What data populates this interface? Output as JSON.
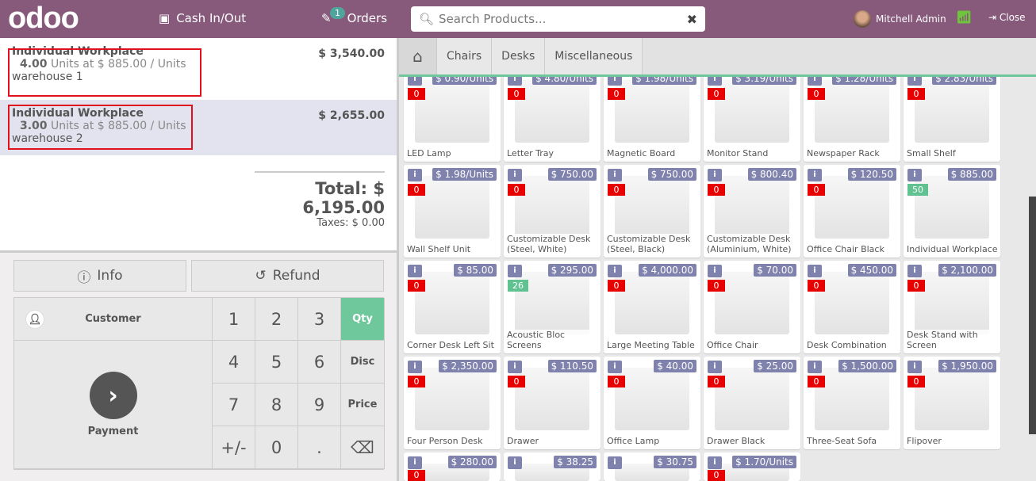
{
  "header": {
    "logo": "odoo",
    "cash": "Cash In/Out",
    "orders": "Orders",
    "orders_count": "1",
    "search_placeholder": "Search Products...",
    "user": "Mitchell Admin",
    "close": "Close"
  },
  "order": {
    "lines": [
      {
        "name": "Individual Workplace",
        "price": "$ 3,540.00",
        "qty": "4.00",
        "detail": "Units at $ 885.00 / Units",
        "note": "warehouse 1"
      },
      {
        "name": "Individual Workplace",
        "price": "$ 2,655.00",
        "qty": "3.00",
        "detail": "Units at $ 885.00 / Units",
        "note": "warehouse 2"
      }
    ],
    "total": "Total: $ 6,195.00",
    "taxes": "Taxes: $ 0.00"
  },
  "actions": {
    "info": "Info",
    "refund": "Refund"
  },
  "pad": {
    "customer": "Customer",
    "payment": "Payment",
    "keys": [
      "1",
      "2",
      "3",
      "Qty",
      "4",
      "5",
      "6",
      "Disc",
      "7",
      "8",
      "9",
      "Price",
      "+/-",
      "0",
      ".",
      "⌫"
    ],
    "active": "Qty"
  },
  "categories": [
    "Chairs",
    "Desks",
    "Miscellaneous"
  ],
  "products": [
    {
      "name": "LED Lamp",
      "price": "$ 0.90/Units",
      "qty": "0"
    },
    {
      "name": "Letter Tray",
      "price": "$ 4.80/Units",
      "qty": "0"
    },
    {
      "name": "Magnetic Board",
      "price": "$ 1.98/Units",
      "qty": "0"
    },
    {
      "name": "Monitor Stand",
      "price": "$ 3.19/Units",
      "qty": "0"
    },
    {
      "name": "Newspaper Rack",
      "price": "$ 1.28/Units",
      "qty": "0"
    },
    {
      "name": "Small Shelf",
      "price": "$ 2.83/Units",
      "qty": "0"
    },
    {
      "name": "Wall Shelf Unit",
      "price": "$ 1.98/Units",
      "qty": "0"
    },
    {
      "name": "Customizable Desk (Steel, White)",
      "price": "$ 750.00",
      "qty": "0"
    },
    {
      "name": "Customizable Desk (Steel, Black)",
      "price": "$ 750.00",
      "qty": "0"
    },
    {
      "name": "Customizable Desk (Aluminium, White)",
      "price": "$ 800.40",
      "qty": "0"
    },
    {
      "name": "Office Chair Black",
      "price": "$ 120.50",
      "qty": "0"
    },
    {
      "name": "Individual Workplace",
      "price": "$ 885.00",
      "qty": "50",
      "pos": true
    },
    {
      "name": "Corner Desk Left Sit",
      "price": "$ 85.00",
      "qty": "0"
    },
    {
      "name": "Acoustic Bloc Screens",
      "price": "$ 295.00",
      "qty": "26",
      "pos": true
    },
    {
      "name": "Large Meeting Table",
      "price": "$ 4,000.00",
      "qty": "0"
    },
    {
      "name": "Office Chair",
      "price": "$ 70.00",
      "qty": "0"
    },
    {
      "name": "Desk Combination",
      "price": "$ 450.00",
      "qty": "0"
    },
    {
      "name": "Desk Stand with Screen",
      "price": "$ 2,100.00",
      "qty": "0"
    },
    {
      "name": "Four Person Desk",
      "price": "$ 2,350.00",
      "qty": "0"
    },
    {
      "name": "Drawer",
      "price": "$ 110.50",
      "qty": "0"
    },
    {
      "name": "Office Lamp",
      "price": "$ 40.00",
      "qty": "0"
    },
    {
      "name": "Drawer Black",
      "price": "$ 25.00",
      "qty": "0"
    },
    {
      "name": "Three-Seat Sofa",
      "price": "$ 1,500.00",
      "qty": "0"
    },
    {
      "name": "Flipover",
      "price": "$ 1,950.00",
      "qty": "0"
    },
    {
      "name": "",
      "price": "$ 280.00",
      "qty": "0"
    },
    {
      "name": "",
      "price": "$ 38.25",
      "qty": ""
    },
    {
      "name": "",
      "price": "$ 30.75",
      "qty": ""
    },
    {
      "name": "",
      "price": "$ 1.70/Units",
      "qty": "0"
    }
  ],
  "colors": {
    "brand": "#875a7b",
    "accent": "#6ec89b",
    "price_tag": "#7f82ac",
    "stock_zero": "#e80000"
  }
}
